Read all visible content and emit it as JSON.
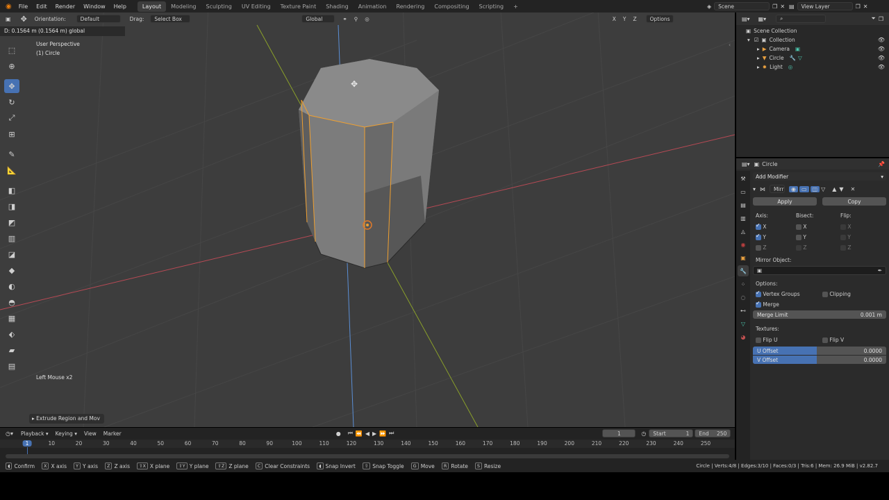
{
  "topbar": {
    "menus": [
      "File",
      "Edit",
      "Render",
      "Window",
      "Help"
    ],
    "workspaces": [
      "Layout",
      "Modeling",
      "Sculpting",
      "UV Editing",
      "Texture Paint",
      "Shading",
      "Animation",
      "Rendering",
      "Compositing",
      "Scripting"
    ],
    "active_workspace": "Layout",
    "scene": "Scene",
    "view_layer": "View Layer"
  },
  "viewport_header": {
    "orientation_label": "Orientation:",
    "orientation_value": "Default",
    "drag_label": "Drag:",
    "drag_value": "Select Box",
    "transform_orientation": "Global",
    "axes": [
      "X",
      "Y",
      "Z"
    ],
    "options": "Options"
  },
  "viewport": {
    "status_text": "D: 0.1564 m (0.1564 m) global",
    "view_name": "User Perspective",
    "object_name": "(1) Circle",
    "last_input": "Left Mouse x2",
    "operator_panel": "Extrude Region and Mov"
  },
  "outliner": {
    "root": "Scene Collection",
    "collection": "Collection",
    "items": [
      {
        "name": "Camera",
        "icon": "camera-icon"
      },
      {
        "name": "Circle",
        "icon": "mesh-icon"
      },
      {
        "name": "Light",
        "icon": "light-icon"
      }
    ]
  },
  "properties": {
    "object_name": "Circle",
    "add_modifier": "Add Modifier",
    "modifier_name": "Mirr",
    "apply": "Apply",
    "copy": "Copy",
    "axis_label": "Axis:",
    "bisect_label": "Bisect:",
    "flip_label": "Flip:",
    "axis": [
      {
        "label": "X",
        "on": true
      },
      {
        "label": "Y",
        "on": true
      },
      {
        "label": "Z",
        "on": false
      }
    ],
    "bisect": [
      "X",
      "Y",
      "Z"
    ],
    "flip": [
      "X",
      "Y",
      "Z"
    ],
    "mirror_object_label": "Mirror Object:",
    "options_label": "Options:",
    "vertex_groups": "Vertex Groups",
    "clipping": "Clipping",
    "merge": "Merge",
    "merge_limit_label": "Merge Limit",
    "merge_limit_value": "0.001 m",
    "textures_label": "Textures:",
    "flip_u": "Flip U",
    "flip_v": "Flip V",
    "u_offset_label": "U Offset",
    "u_offset_value": "0.0000",
    "v_offset_label": "V Offset",
    "v_offset_value": "0.0000"
  },
  "timeline": {
    "menus": [
      "Playback",
      "Keying",
      "View",
      "Marker"
    ],
    "current_frame": "1",
    "start_label": "Start",
    "start_value": "1",
    "end_label": "End",
    "end_value": "250",
    "ruler": [
      "1",
      "10",
      "20",
      "30",
      "40",
      "50",
      "60",
      "70",
      "80",
      "90",
      "100",
      "110",
      "120",
      "130",
      "140",
      "150",
      "160",
      "170",
      "180",
      "190",
      "200",
      "210",
      "220",
      "230",
      "240",
      "250"
    ]
  },
  "statusbar": {
    "items": [
      {
        "key": "",
        "label": "Confirm"
      },
      {
        "key": "X",
        "label": "X axis"
      },
      {
        "key": "Y",
        "label": "Y axis"
      },
      {
        "key": "Z",
        "label": "Z axis"
      },
      {
        "key": "⇧X",
        "label": "X plane"
      },
      {
        "key": "⇧Y",
        "label": "Y plane"
      },
      {
        "key": "⇧Z",
        "label": "Z plane"
      },
      {
        "key": "C",
        "label": "Clear Constraints"
      },
      {
        "key": "",
        "label": "Snap Invert"
      },
      {
        "key": "⇧",
        "label": "Snap Toggle"
      },
      {
        "key": "G",
        "label": "Move"
      },
      {
        "key": "R",
        "label": "Rotate"
      },
      {
        "key": "S",
        "label": "Resize"
      }
    ],
    "stats": "Circle | Verts:4/8 | Edges:3/10 | Faces:0/3 | Tris:6 | Mem: 26.9 MiB | v2.82.7"
  }
}
